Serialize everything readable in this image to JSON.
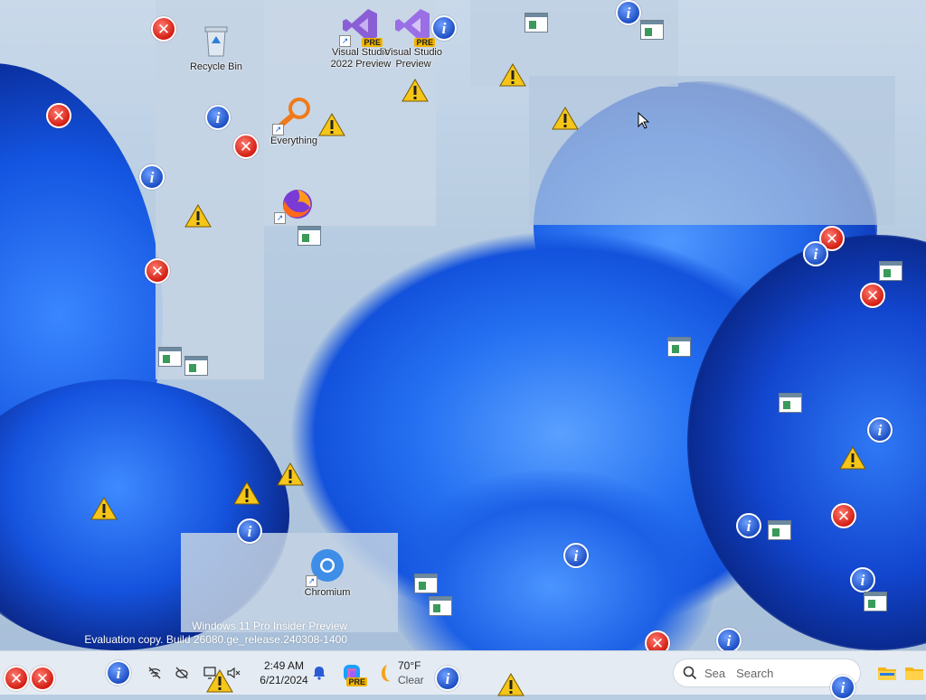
{
  "desktop": {
    "shortcuts": [
      {
        "label": "Recycle Bin",
        "icon": "recycle-bin-icon"
      },
      {
        "label": "Visual Studio 2022 Preview",
        "icon": "visual-studio-icon",
        "badge": "PRE"
      },
      {
        "label": "Visual Studio Preview",
        "icon": "visual-studio-installer-icon",
        "badge": "PRE"
      },
      {
        "label": "Everything",
        "icon": "everything-search-icon"
      },
      {
        "label": "Firefox",
        "icon": "firefox-icon"
      },
      {
        "label": "Chromium",
        "icon": "chromium-icon"
      }
    ],
    "watermark": {
      "line1": "Windows 11 Pro Insider Preview",
      "line2": "Evaluation copy. Build 26080.ge_release.240308-1400"
    },
    "message_icons": {
      "error_glyph": "✕",
      "info_glyph": "i"
    }
  },
  "taskbar": {
    "clock": {
      "time": "2:49 AM",
      "date": "6/21/2024"
    },
    "weather": {
      "temp": "70°F",
      "condition": "Clear"
    },
    "search": {
      "placeholder": "Search",
      "prefix": "Sea"
    },
    "copilot_badge": "PRE"
  },
  "colors": {
    "wallpaper_blue": "#1a5fe6",
    "error_red": "#d41d12",
    "info_blue": "#1d4fc4",
    "warning_yellow": "#f5c518"
  }
}
